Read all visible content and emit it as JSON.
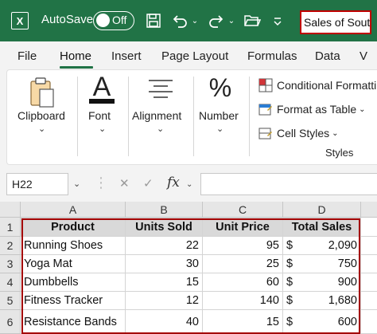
{
  "titlebar": {
    "app_letter": "X",
    "autosave_label": "AutoSave",
    "autosave_state": "Off",
    "document_title": "Sales of South"
  },
  "tabs": [
    "File",
    "Home",
    "Insert",
    "Page Layout",
    "Formulas",
    "Data",
    "V"
  ],
  "ribbon": {
    "clipboard": "Clipboard",
    "font": "Font",
    "alignment": "Alignment",
    "number": "Number",
    "conditional_formatting": "Conditional Formatti",
    "format_as_table": "Format as Table",
    "cell_styles": "Cell Styles",
    "styles_group": "Styles",
    "number_symbol": "%",
    "font_symbol": "A"
  },
  "formula_bar": {
    "name_box": "H22",
    "cancel_symbol": "✕",
    "enter_symbol": "✓",
    "fx_symbol": "fx",
    "formula_value": ""
  },
  "grid": {
    "columns": [
      "A",
      "B",
      "C",
      "D"
    ],
    "rows": [
      "1",
      "2",
      "3",
      "4",
      "5",
      "6"
    ],
    "headers": [
      "Product",
      "Units Sold",
      "Unit Price",
      "Total Sales"
    ],
    "data": [
      {
        "product": "Running Shoes",
        "units": "22",
        "price": "95",
        "currency": "$",
        "total": "2,090"
      },
      {
        "product": "Yoga Mat",
        "units": "30",
        "price": "25",
        "currency": "$",
        "total": "750"
      },
      {
        "product": "Dumbbells",
        "units": "15",
        "price": "60",
        "currency": "$",
        "total": "900"
      },
      {
        "product": "Fitness Tracker",
        "units": "12",
        "price": "140",
        "currency": "$",
        "total": "1,680"
      },
      {
        "product": "Resistance Bands",
        "units": "40",
        "price": "15",
        "currency": "$",
        "total": "600"
      }
    ]
  },
  "colors": {
    "brand_green": "#217346",
    "highlight_red": "#a40000"
  }
}
